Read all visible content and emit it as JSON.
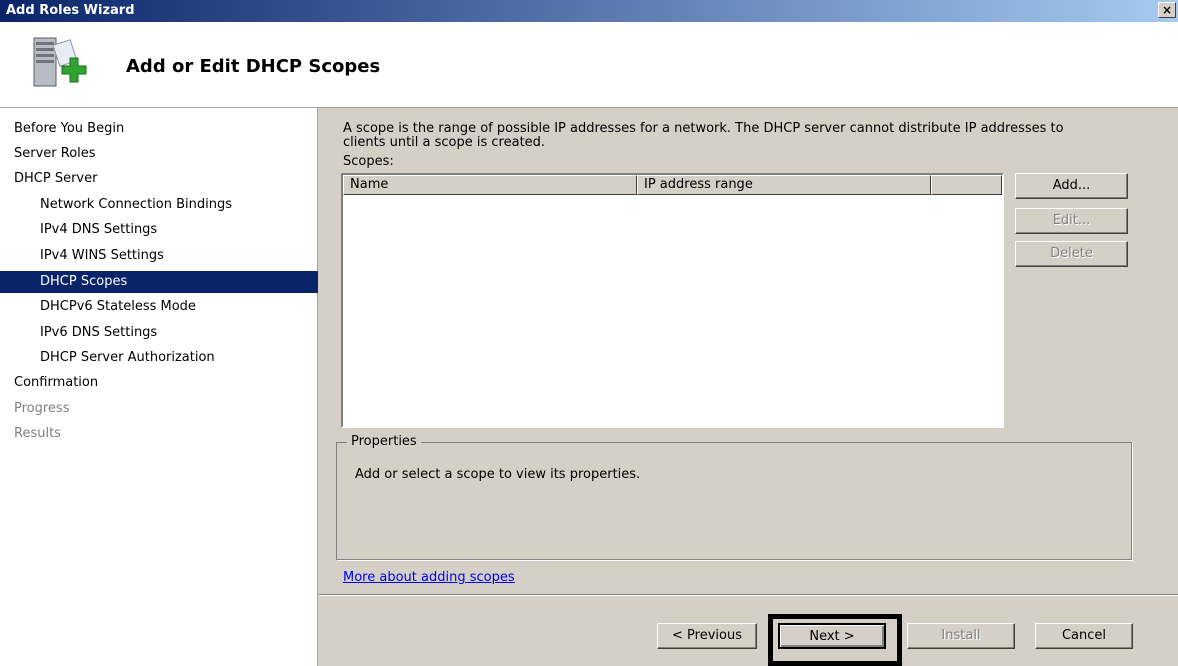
{
  "window": {
    "title": "Add Roles Wizard",
    "close_glyph": "×"
  },
  "header": {
    "heading": "Add or Edit DHCP Scopes",
    "icon": "server-add-icon"
  },
  "sidebar": {
    "items": [
      {
        "label": "Before You Begin",
        "level": 0,
        "state": "normal"
      },
      {
        "label": "Server Roles",
        "level": 0,
        "state": "normal"
      },
      {
        "label": "DHCP Server",
        "level": 0,
        "state": "normal"
      },
      {
        "label": "Network Connection Bindings",
        "level": 1,
        "state": "normal"
      },
      {
        "label": "IPv4 DNS Settings",
        "level": 1,
        "state": "normal"
      },
      {
        "label": "IPv4 WINS Settings",
        "level": 1,
        "state": "normal"
      },
      {
        "label": "DHCP Scopes",
        "level": 1,
        "state": "selected"
      },
      {
        "label": "DHCPv6 Stateless Mode",
        "level": 1,
        "state": "normal"
      },
      {
        "label": "IPv6 DNS Settings",
        "level": 1,
        "state": "normal"
      },
      {
        "label": "DHCP Server Authorization",
        "level": 1,
        "state": "normal"
      },
      {
        "label": "Confirmation",
        "level": 0,
        "state": "normal"
      },
      {
        "label": "Progress",
        "level": 0,
        "state": "disabled"
      },
      {
        "label": "Results",
        "level": 0,
        "state": "disabled"
      }
    ]
  },
  "main": {
    "description": "A scope is the range of possible IP addresses for a network. The DHCP server cannot distribute IP addresses to clients until a scope is created.",
    "scopes_label": "Scopes:",
    "columns": [
      "Name",
      "IP address range",
      ""
    ],
    "buttons": {
      "add": "Add...",
      "edit": "Edit...",
      "delete": "Delete"
    },
    "properties": {
      "legend": "Properties",
      "text": "Add or select a scope to view its properties."
    },
    "more_link": "More about adding scopes"
  },
  "footer": {
    "previous": "< Previous",
    "next": "Next >",
    "install": "Install",
    "cancel": "Cancel"
  }
}
